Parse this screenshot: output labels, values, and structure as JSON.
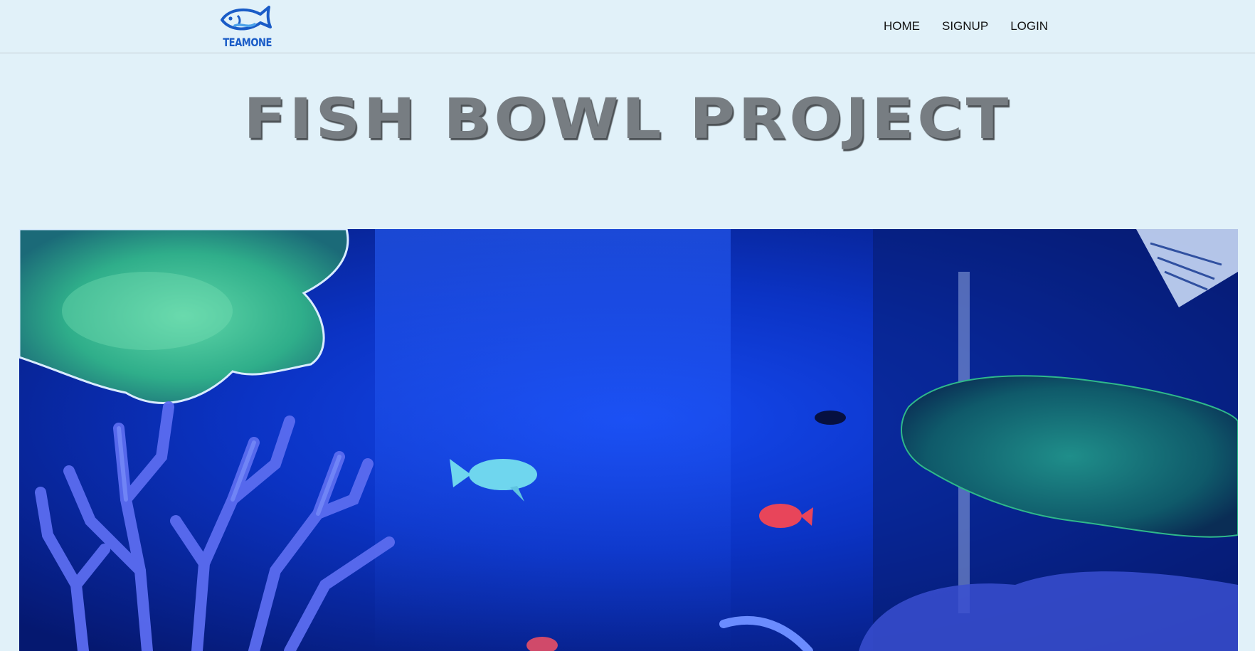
{
  "brand": {
    "logo_text": "TEAMONE",
    "logo_icon": "fish-icon",
    "logo_color": "#1a5cc7"
  },
  "nav": {
    "items": [
      {
        "label": "HOME"
      },
      {
        "label": "SIGNUP"
      },
      {
        "label": "LOGIN"
      }
    ]
  },
  "hero": {
    "title": "FISH BOWL PROJECT",
    "title_color": "#777d82",
    "image_subject": "aquarium-scene"
  },
  "colors": {
    "background": "#e1f1f9",
    "aquarium_blue": "#0a35c8"
  }
}
